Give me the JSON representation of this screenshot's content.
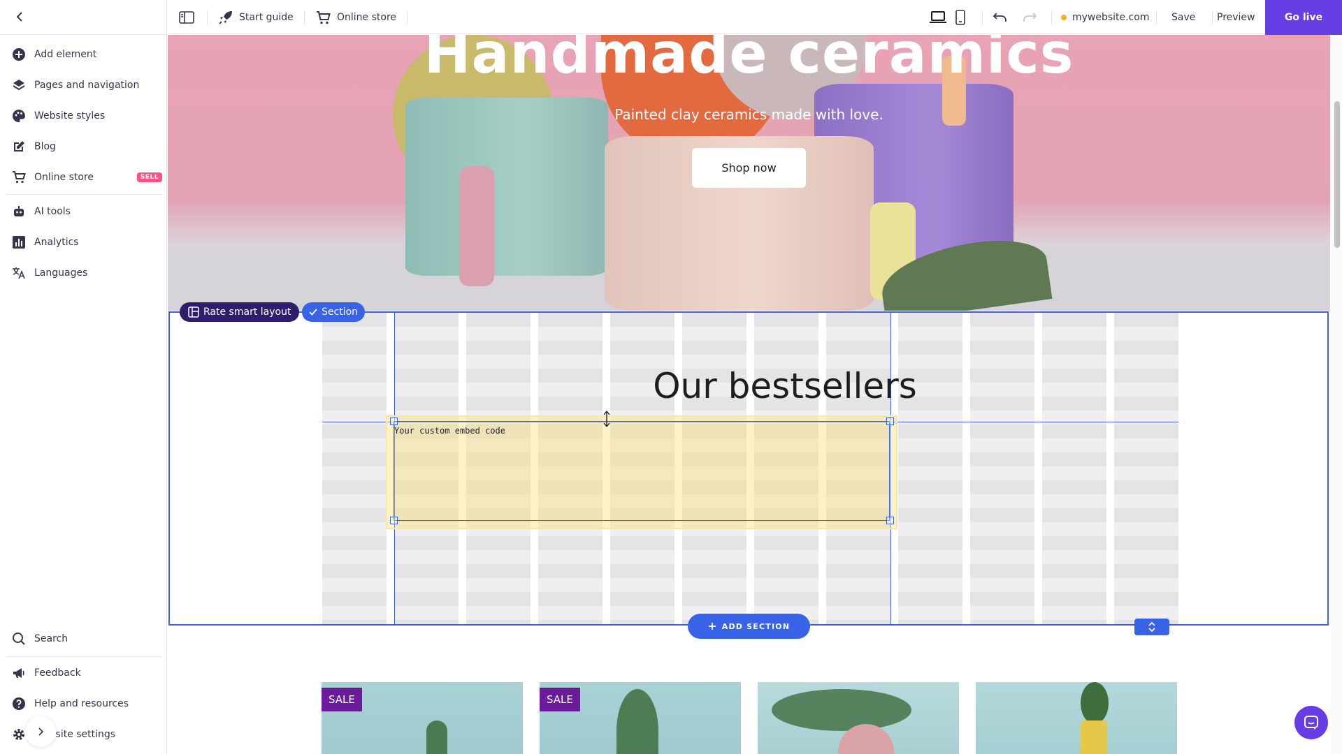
{
  "sidebar": {
    "items": [
      {
        "label": "Add element",
        "icon": "plus-circle-icon"
      },
      {
        "label": "Pages and navigation",
        "icon": "layers-icon"
      },
      {
        "label": "Website styles",
        "icon": "palette-icon"
      },
      {
        "label": "Blog",
        "icon": "edit-icon"
      },
      {
        "label": "Online store",
        "icon": "cart-icon",
        "badge": "SELL"
      },
      {
        "label": "AI tools",
        "icon": "robot-icon"
      },
      {
        "label": "Analytics",
        "icon": "chart-icon"
      },
      {
        "label": "Languages",
        "icon": "translate-icon"
      }
    ],
    "bottom_items": [
      {
        "label": "Search",
        "icon": "search-icon"
      },
      {
        "label": "Feedback",
        "icon": "megaphone-icon"
      },
      {
        "label": "Help and resources",
        "icon": "help-icon"
      },
      {
        "label": "Website settings",
        "icon": "gear-icon"
      }
    ]
  },
  "topbar": {
    "start_guide": "Start guide",
    "online_store": "Online store",
    "domain": "mywebsite.com",
    "save": "Save",
    "preview": "Preview",
    "go_live": "Go live"
  },
  "hero": {
    "title": "Handmade ceramics",
    "subtitle": "Painted clay ceramics made with love.",
    "button": "Shop now"
  },
  "section": {
    "rate_label": "Rate smart layout",
    "section_label": "Section",
    "title": "Our bestsellers",
    "embed_text": "Your custom embed code",
    "add_section": "ADD SECTION"
  },
  "products": [
    {
      "badge": "SALE"
    },
    {
      "badge": "SALE"
    },
    {
      "badge": ""
    },
    {
      "badge": ""
    }
  ],
  "colors": {
    "accent": "#673de6",
    "selection": "#3863e6",
    "badge_sell": "#fc5185",
    "sale_badge": "#6a1b9a"
  }
}
